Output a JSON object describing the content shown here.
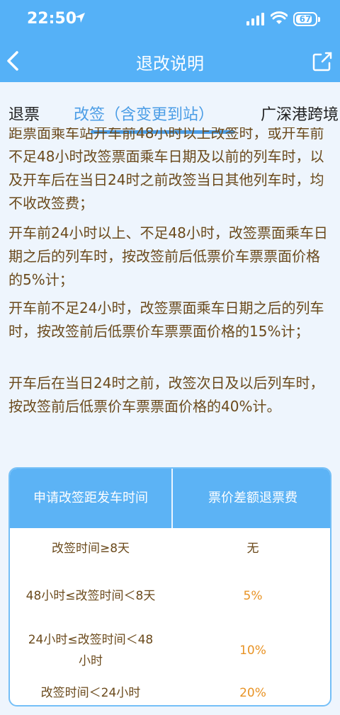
{
  "status": {
    "time": "22:50",
    "battery": "67"
  },
  "header": {
    "title": "退改说明"
  },
  "tabs": [
    {
      "label": "退票"
    },
    {
      "label": "改签（含变更到站）"
    },
    {
      "label": "广深港跨境"
    }
  ],
  "content": {
    "paragraphs": [
      "距票面乘车站开车前48小时以上改签时，或开车前不足48小时改签票面乘车日期及以前的列车时，以及开车后在当日24时之前改签当日其他列车时，均不收改签费；",
      "开车前24小时以上、不足48小时，改签票面乘车日期之后的列车时，按改签前后低票价车票票面价格的5%计；",
      "开车前不足24小时，改签票面乘车日期之后的列车时，按改签前后低票价车票票面价格的15%计；",
      "开车后在当日24时之前，改签次日及以后列车时，按改签前后低票价车票票面价格的40%计。"
    ]
  },
  "table": {
    "headers": [
      "申请改签距发车时间",
      "票价差额退票费"
    ],
    "rows": [
      {
        "time": "改签时间≥8天",
        "fee": "无"
      },
      {
        "time": "48小时≤改签时间＜8天",
        "fee": "5%"
      },
      {
        "time": "24小时≤改签时间＜48小时",
        "fee": "10%"
      },
      {
        "time": "改签时间＜24小时",
        "fee": "20%"
      }
    ]
  },
  "colors": {
    "header_bg": "#55b1f7",
    "accent": "#4b9de6",
    "body_text": "#6b4a1c",
    "fee_text": "#e89325"
  }
}
